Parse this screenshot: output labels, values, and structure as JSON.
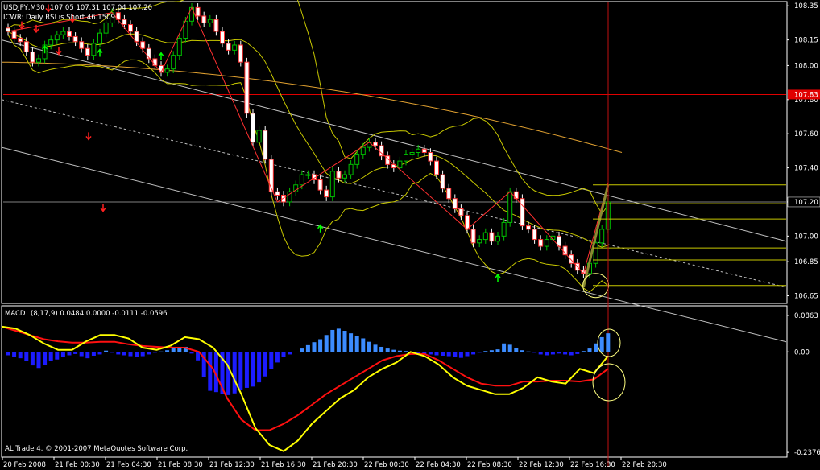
{
  "window": {
    "title": "USDJPY,M30",
    "ohlc": "107.05 107.31 107.04 107.20",
    "indicator_line": "ICWR: Daily RSI is Short 46.1509",
    "macd_title": "MACD",
    "macd_params": "(8,17,9) 0.0484 0.0000 -0.0111 -0.0596",
    "footer": "AL Trade 4, © 2001-2007 MetaQuotes Software Corp."
  },
  "colors": {
    "background": "#000000",
    "frame": "#ffffff",
    "bull": "#00c000",
    "bear": "#ffffff",
    "bollinger": "#c8c800",
    "channel": "#c0c0c0",
    "ma_slow": "#e0a030",
    "hline_red": "#e00000",
    "hist_neg": "#1c1cff",
    "hist_pos": "#3c8cff",
    "macd_main": "#ffff00",
    "macd_signal": "#ff1010",
    "arrow_up": "#00ff00",
    "arrow_down": "#ff2020"
  },
  "chart_data": [
    {
      "type": "line",
      "name": "price",
      "x_ticks": [
        "20 Feb 2008",
        "21 Feb 00:30",
        "21 Feb 04:30",
        "21 Feb 08:30",
        "21 Feb 12:30",
        "21 Feb 16:30",
        "21 Feb 20:30",
        "22 Feb 00:30",
        "22 Feb 04:30",
        "22 Feb 08:30",
        "22 Feb 12:30",
        "22 Feb 16:30",
        "22 Feb 20:30"
      ],
      "y_ticks": [
        106.65,
        106.85,
        107.0,
        107.2,
        107.4,
        107.6,
        107.8,
        108.0,
        108.15,
        108.35
      ],
      "y_tick_labels": [
        "106.65",
        "106.85",
        "107.00",
        "107.20",
        "107.40",
        "107.60",
        "107.80",
        "108.00",
        "108.15",
        "108.35"
      ],
      "ylim": [
        106.61,
        108.37
      ],
      "current_price": 107.2,
      "red_level": 107.83,
      "red_level_label": "107.83",
      "close": [
        108.2,
        108.16,
        108.14,
        108.08,
        108.02,
        108.04,
        108.12,
        108.15,
        108.18,
        108.2,
        108.17,
        108.14,
        108.1,
        108.06,
        108.13,
        108.19,
        108.25,
        108.31,
        108.27,
        108.24,
        108.2,
        108.14,
        108.1,
        108.04,
        108.0,
        107.96,
        107.98,
        108.06,
        108.16,
        108.26,
        108.34,
        108.29,
        108.25,
        108.27,
        108.2,
        108.13,
        108.09,
        108.12,
        108.02,
        107.72,
        107.55,
        107.62,
        107.45,
        107.26,
        107.24,
        107.2,
        107.26,
        107.3,
        107.36,
        107.36,
        107.33,
        107.27,
        107.23,
        107.38,
        107.34,
        107.36,
        107.42,
        107.48,
        107.52,
        107.55,
        107.53,
        107.47,
        107.42,
        107.4,
        107.44,
        107.48,
        107.49,
        107.51,
        107.49,
        107.44,
        107.36,
        107.28,
        107.22,
        107.16,
        107.12,
        107.04,
        106.96,
        106.98,
        107.02,
        106.97,
        107.0,
        107.08,
        107.26,
        107.22,
        107.06,
        107.04,
        106.98,
        106.94,
        106.98,
        107.0,
        106.94,
        106.89,
        106.84,
        106.8,
        106.78,
        106.84,
        106.96,
        107.04,
        107.2
      ],
      "arrows_down": [
        [
          27,
          108.23
        ],
        [
          45,
          108.21
        ],
        [
          60,
          108.33
        ],
        [
          73,
          108.08
        ],
        [
          90,
          108.27
        ],
        [
          110,
          107.58
        ],
        [
          128,
          107.16
        ]
      ],
      "arrows_up": [
        [
          6,
          108.1
        ],
        [
          15,
          108.08
        ],
        [
          25,
          108.06
        ],
        [
          51,
          107.05
        ],
        [
          80,
          106.76
        ]
      ]
    },
    {
      "type": "bar",
      "name": "MACD",
      "y_ticks": [
        0.0863,
        0.0,
        -0.2376
      ],
      "y_tick_labels": [
        "0.0863",
        "0.00",
        "-0.2376"
      ],
      "ylim": [
        -0.245,
        0.09
      ],
      "histogram": [
        -0.008,
        -0.012,
        -0.015,
        -0.022,
        -0.032,
        -0.038,
        -0.03,
        -0.022,
        -0.018,
        -0.012,
        -0.008,
        -0.005,
        -0.01,
        -0.015,
        -0.009,
        -0.006,
        0.003,
        -0.002,
        -0.006,
        -0.008,
        -0.01,
        -0.012,
        -0.01,
        -0.006,
        -0.002,
        0.001,
        0.004,
        0.01,
        0.012,
        0.012,
        -0.004,
        -0.02,
        -0.06,
        -0.092,
        -0.095,
        -0.1,
        -0.102,
        -0.098,
        -0.09,
        -0.085,
        -0.082,
        -0.072,
        -0.058,
        -0.04,
        -0.025,
        -0.012,
        -0.006,
        0.0,
        0.008,
        0.016,
        0.023,
        0.03,
        0.04,
        0.052,
        0.055,
        0.05,
        0.044,
        0.038,
        0.032,
        0.024,
        0.017,
        0.012,
        0.008,
        0.005,
        0.003,
        0.002,
        0.0,
        -0.003,
        -0.005,
        -0.006,
        -0.008,
        -0.009,
        -0.01,
        -0.012,
        -0.014,
        -0.01,
        -0.006,
        -0.002,
        0.002,
        0.004,
        0.006,
        0.02,
        0.017,
        0.01,
        0.004,
        0.001,
        -0.002,
        -0.006,
        -0.008,
        -0.006,
        -0.004,
        -0.006,
        -0.008,
        -0.005,
        0.002,
        0.008,
        0.02,
        0.035,
        0.044
      ],
      "macd_main": [
        0.06,
        0.055,
        0.04,
        0.02,
        0.005,
        0.005,
        0.025,
        0.04,
        0.04,
        0.032,
        0.01,
        0.005,
        0.015,
        0.035,
        0.03,
        0.01,
        -0.03,
        -0.1,
        -0.18,
        -0.22,
        -0.235,
        -0.21,
        -0.17,
        -0.14,
        -0.11,
        -0.09,
        -0.06,
        -0.04,
        -0.025,
        0.0,
        -0.01,
        -0.03,
        -0.06,
        -0.08,
        -0.09,
        -0.1,
        -0.1,
        -0.085,
        -0.06,
        -0.07,
        -0.075,
        -0.04,
        -0.05,
        -0.01
      ],
      "macd_signal": [
        0.06,
        0.05,
        0.04,
        0.03,
        0.025,
        0.022,
        0.022,
        0.024,
        0.024,
        0.018,
        0.014,
        0.012,
        0.01,
        0.01,
        0.0,
        -0.04,
        -0.11,
        -0.16,
        -0.185,
        -0.185,
        -0.17,
        -0.15,
        -0.125,
        -0.1,
        -0.08,
        -0.06,
        -0.04,
        -0.02,
        -0.01,
        -0.005,
        -0.005,
        -0.02,
        -0.04,
        -0.06,
        -0.075,
        -0.08,
        -0.08,
        -0.07,
        -0.07,
        -0.068,
        -0.068,
        -0.07,
        -0.065,
        -0.04
      ]
    }
  ]
}
